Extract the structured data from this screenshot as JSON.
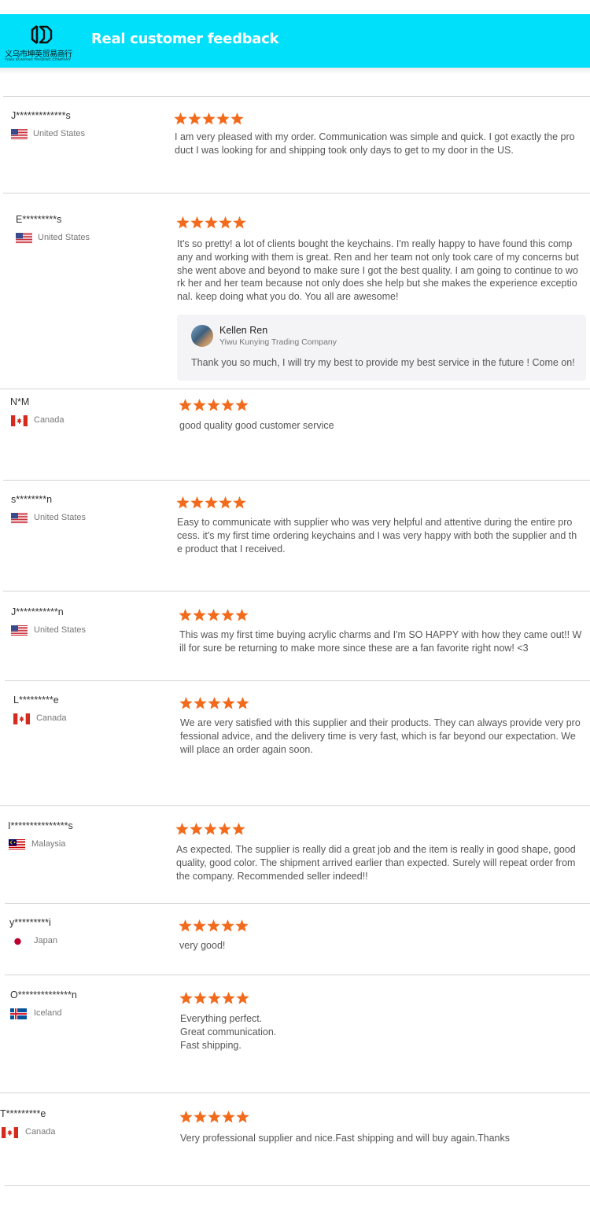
{
  "header": {
    "logo_cn": "义乌市坤英贸易商行",
    "logo_en": "YIWU KUNYING TRADING COMPANY",
    "title": "Real customer feedback",
    "background": "#00e0fb"
  },
  "star_color": "#f26b1d",
  "reviews": [
    {
      "name": "J*************s",
      "country": "United States",
      "flag": "us-flag-icon",
      "rating": 5,
      "text": "I am very pleased with my order. Communication was simple and quick. I got exactly the pro\nduct I was looking for and shipping took only days to get to my door in the US."
    },
    {
      "name": "E*********s",
      "country": "United States",
      "flag": "us-flag-icon",
      "rating": 5,
      "text": "It's so pretty! a lot of clients bought the keychains. I'm really happy to have found this comp\nany and working with them is great. Ren and her team not only took care of my concerns but\nshe went above and beyond to make sure I got the best quality. I am going to continue to wo\nrk her and her team because not only does she help but she makes the experience exceptio\nnal. keep doing what you do. You all are awesome!",
      "reply": {
        "name": "Kellen Ren",
        "company": "Yiwu Kunying Trading Company",
        "text": "Thank you so much, I will try my best to provide my best service in the future ! Come on!"
      }
    },
    {
      "name": "N*M",
      "country": "Canada",
      "flag": "canada-flag-icon",
      "rating": 5,
      "text": "good quality good customer service"
    },
    {
      "name": "s********n",
      "country": "United States",
      "flag": "us-flag-icon",
      "rating": 5,
      "text": "Easy to communicate with supplier who was very helpful and attentive during the entire pro\ncess. it's my first time ordering keychains and I was very happy with both the supplier and th\ne product that I received."
    },
    {
      "name": "J***********n",
      "country": "United States",
      "flag": "us-flag-icon",
      "rating": 5,
      "text": "This was my first time buying acrylic charms and I'm SO HAPPY with how they came out!! W\nill for sure be returning to make more since these are a fan favorite right now! <3"
    },
    {
      "name": "L*********e",
      "country": "Canada",
      "flag": "canada-flag-icon",
      "rating": 5,
      "text": "We are very satisfied with this supplier and their products. They can always provide very pro\nfessional advice, and the delivery time is very fast, which is far beyond our expectation. We\nwill place an order again soon."
    },
    {
      "name": "I***************s",
      "country": "Malaysia",
      "flag": "malaysia-flag-icon",
      "rating": 5,
      "text": "As expected. The supplier is really did a great job and the item is really in good shape, good\nquality, good color. The shipment arrived earlier than expected. Surely will repeat order from\nthe company. Recommended seller indeed!!"
    },
    {
      "name": "y*********i",
      "country": "Japan",
      "flag": "japan-flag-icon",
      "rating": 5,
      "text": "very good!"
    },
    {
      "name": "O**************n",
      "country": "Iceland",
      "flag": "iceland-flag-icon",
      "rating": 5,
      "text": "Everything perfect.\nGreat communication.\nFast shipping."
    },
    {
      "name": "T*********e",
      "country": "Canada",
      "flag": "canada-flag-icon",
      "rating": 5,
      "text": "Very professional supplier and nice.Fast shipping and will buy again.Thanks"
    }
  ]
}
